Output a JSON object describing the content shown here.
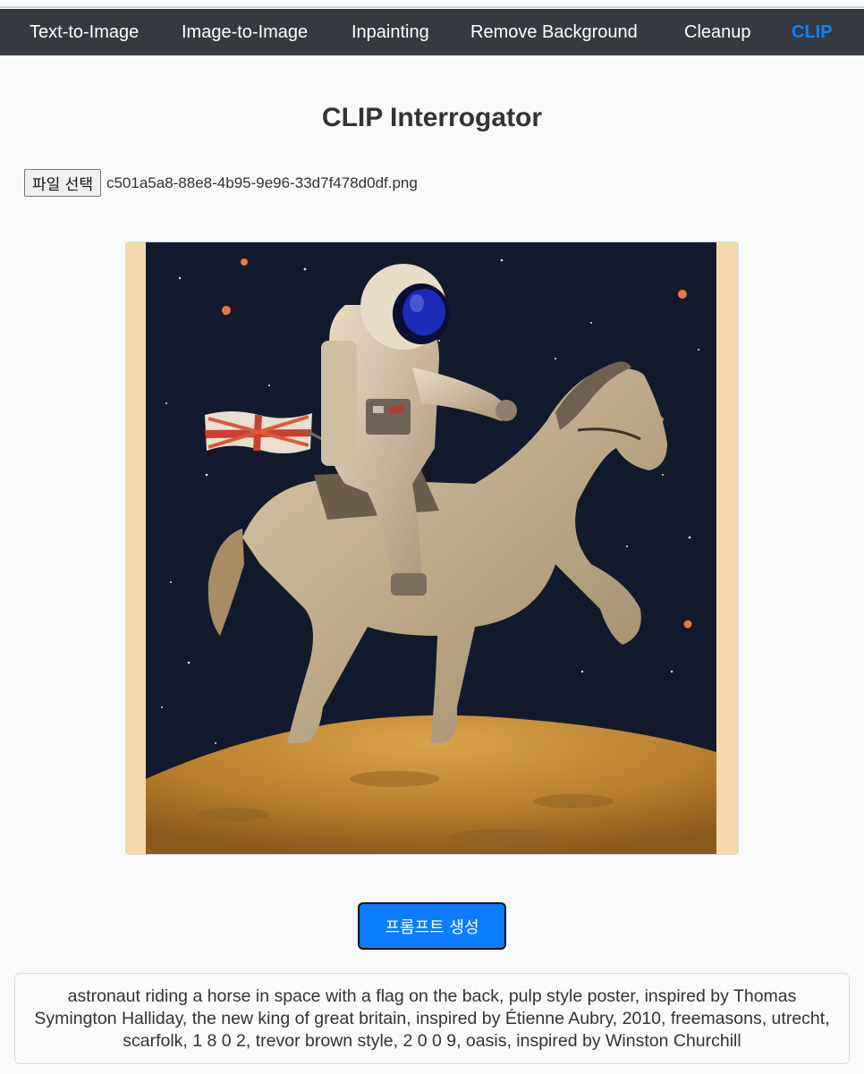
{
  "nav": {
    "items": [
      {
        "label": "Text-to-Image"
      },
      {
        "label": "Image-to-Image"
      },
      {
        "label": "Inpainting"
      },
      {
        "label": "Remove Background"
      },
      {
        "label": "Cleanup"
      },
      {
        "label": "CLIP"
      }
    ],
    "active_index": 5,
    "bar_color": "#343a40",
    "active_color": "#0a84ff"
  },
  "page": {
    "title": "CLIP Interrogator"
  },
  "file_input": {
    "button_label": "파일 선택",
    "file_name": "c501a5a8-88e8-4b95-9e96-33d7f478d0df.png"
  },
  "preview": {
    "description_icon": "uploaded-image-preview"
  },
  "generate_button": {
    "label": "프롬프트 생성",
    "color": "#0a7cff"
  },
  "result": {
    "text": "astronaut riding a horse in space with a flag on the back, pulp style poster, inspired by Thomas Symington Halliday, the new king of great britain, inspired by Étienne Aubry, 2010, freemasons, utrecht, scarfolk, 1 8 0 2, trevor brown style, 2 0 0 9, oasis, inspired by Winston Churchill"
  }
}
